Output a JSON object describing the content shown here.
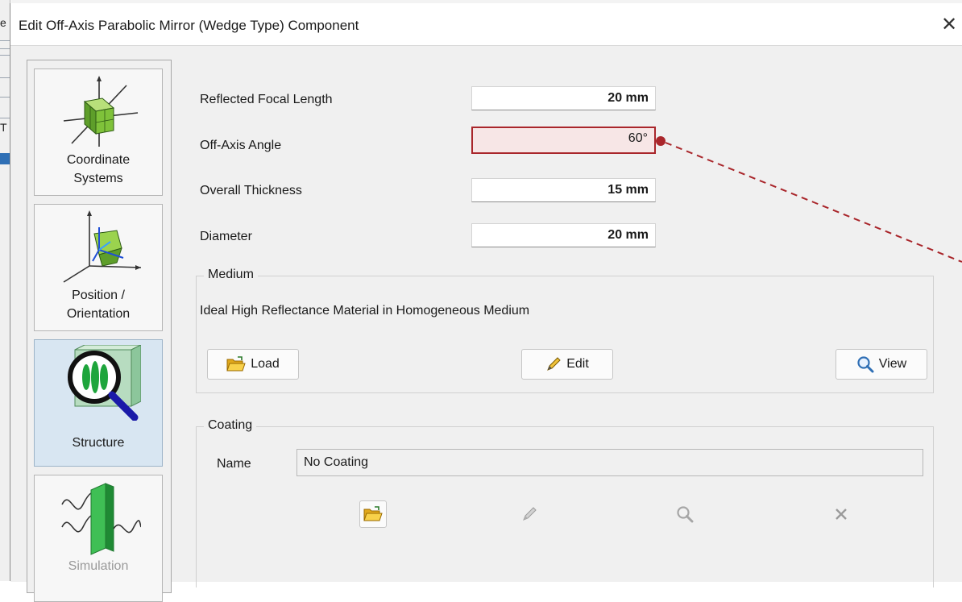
{
  "dialog": {
    "title": "Edit Off-Axis Parabolic Mirror (Wedge Type) Component",
    "close_glyph": "✕"
  },
  "background": {
    "fragment_top": "e",
    "fragment_mid": "T"
  },
  "nav": {
    "items": [
      {
        "label_line1": "Coordinate",
        "label_line2": "Systems",
        "icon": "coordinate-systems-icon",
        "active": false
      },
      {
        "label_line1": "Position /",
        "label_line2": "Orientation",
        "icon": "position-orientation-icon",
        "active": false
      },
      {
        "label_line1": "Structure",
        "label_line2": "",
        "icon": "structure-magnifier-icon",
        "active": true
      },
      {
        "label_line1": "Simulation",
        "label_line2": "",
        "icon": "simulation-icon",
        "active": false
      }
    ]
  },
  "form": {
    "reflected_focal_length": {
      "label": "Reflected Focal Length",
      "value": "20 mm"
    },
    "off_axis_angle": {
      "label": "Off-Axis Angle",
      "value": "60°"
    },
    "overall_thickness": {
      "label": "Overall Thickness",
      "value": "15 mm"
    },
    "diameter": {
      "label": "Diameter",
      "value": "20 mm"
    }
  },
  "medium": {
    "group_title": "Medium",
    "description": "Ideal High Reflectance Material in Homogeneous Medium",
    "load_label": "Load",
    "edit_label": "Edit",
    "view_label": "View"
  },
  "coating": {
    "group_title": "Coating",
    "name_label": "Name",
    "name_value": "No Coating",
    "tools": [
      "folder-open-icon",
      "pencil-icon",
      "magnifier-icon",
      "delete-x-icon"
    ]
  },
  "colors": {
    "highlight_border": "#a9262b",
    "highlight_fill": "#f7e6e6",
    "annotation": "#a9262b",
    "active_nav": "#d8e6f2",
    "accent_blue": "#2f6fb5"
  }
}
